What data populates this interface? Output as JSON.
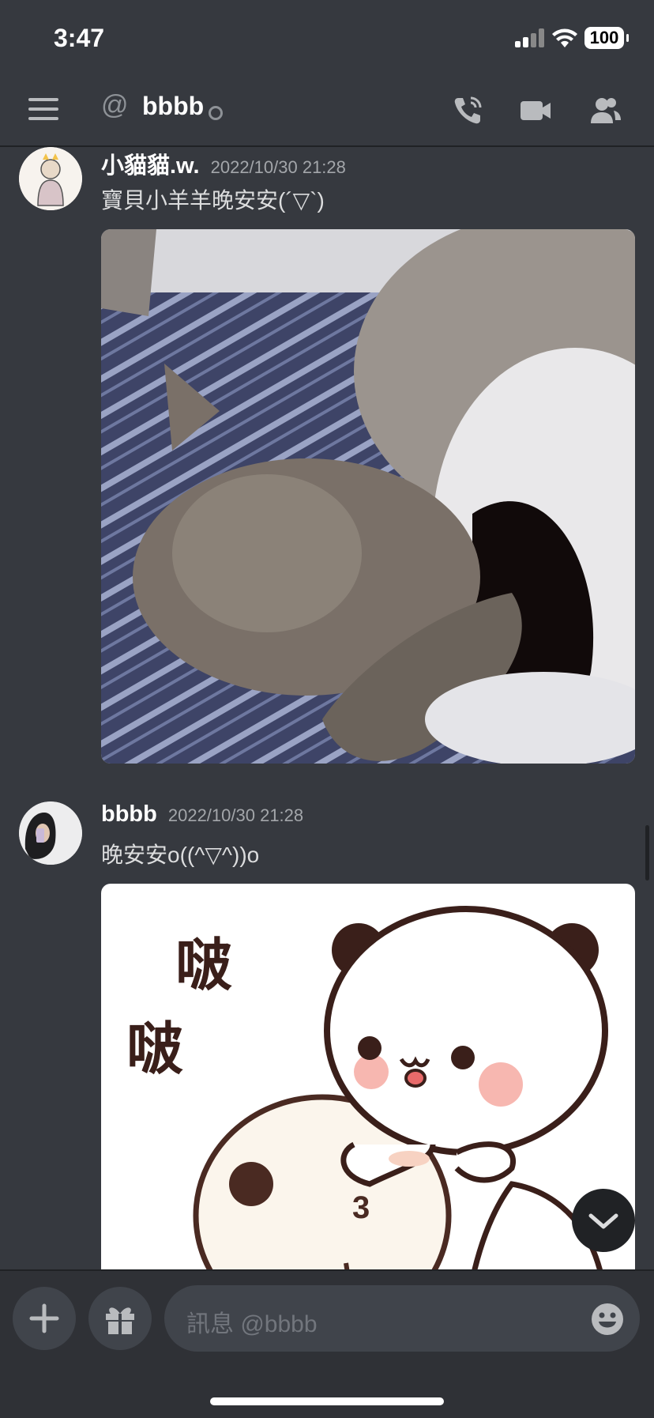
{
  "status_bar": {
    "time": "3:47",
    "battery": "100"
  },
  "header": {
    "at_symbol": "@",
    "channel_name": "bbbb"
  },
  "messages": [
    {
      "author": "小貓貓.w.",
      "timestamp": "2022/10/30 21:28",
      "text": "寶貝小羊羊晚安安(´▽`)",
      "attachment": "cat-sleeping-gif"
    },
    {
      "author": "bbbb",
      "timestamp": "2022/10/30 21:28",
      "text": "晚安安o((^▽^))o",
      "attachment": "panda-sticker"
    }
  ],
  "sticker": {
    "text_top": "啵",
    "text_bottom": "啵",
    "number": "3"
  },
  "composer": {
    "placeholder": "訊息 @bbbb"
  },
  "colors": {
    "background": "#36393f",
    "composer": "#2f3136",
    "input": "#40444b",
    "accent": "#5865f2"
  }
}
